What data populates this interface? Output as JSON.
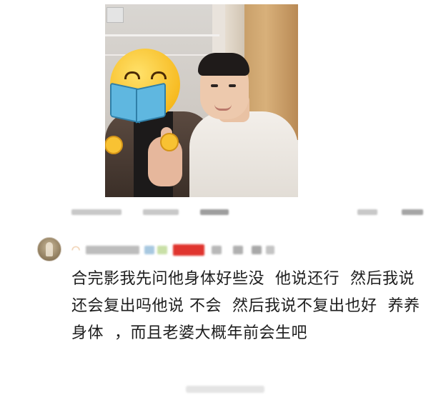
{
  "post": {
    "photo_overlay_icon": "emoji-smiling-face-reading-book"
  },
  "comment": {
    "avatar_icon": "user-avatar",
    "text": "合完影我先问他身体好些没  他说还行  然后我说还会复出吗他说 不会  然后我说不复出也好  养养身体  ，而且老婆大概年前会生吧"
  },
  "colors": {
    "text": "#1d1d1d",
    "redaction_red": "#e0352f"
  }
}
